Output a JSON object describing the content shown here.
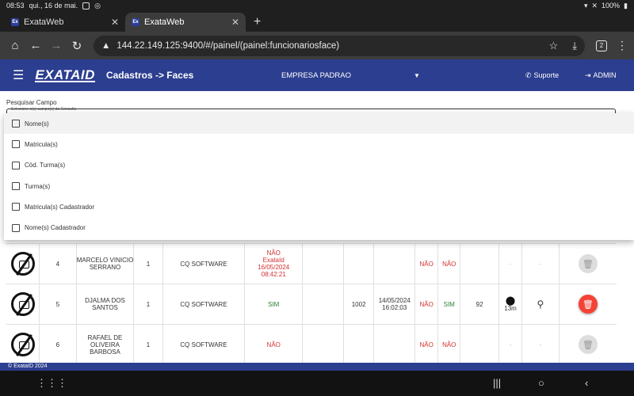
{
  "status": {
    "time": "08:53",
    "date": "qui., 16 de mai.",
    "battery": "100%"
  },
  "tabs": [
    {
      "title": "ExataWeb",
      "favicon": "Ex"
    },
    {
      "title": "ExataWeb",
      "favicon": "Ex"
    }
  ],
  "browser": {
    "url": "144.22.149.125:9400/#/painel/(painel:funcionariosface)",
    "tab_count": "2"
  },
  "app": {
    "logo": "EXATAID",
    "breadcrumb": "Cadastros -> Faces",
    "company": "EMPRESA PADRAO",
    "support": "Suporte",
    "admin": "ADMIN"
  },
  "search": {
    "label": "Pesquisar Campo",
    "field_label": "Selecione o(s) campo(s) da Consulta"
  },
  "dropdown": {
    "options": [
      "Nome(s)",
      "Matricula(s)",
      "Cód. Turma(s)",
      "Turma(s)",
      "Matricula(s) Cadastrador",
      "Nome(s) Cadastrador"
    ]
  },
  "rows": [
    {
      "index": "4",
      "name": "MARCELO VINICIO SERRANO",
      "qty": "1",
      "software": "CQ SOFTWARE",
      "status": "NÃO",
      "status_by": "ExataId",
      "status_date": "16/05/2024",
      "status_time": "08:42:21",
      "matricula": "",
      "date": "",
      "time": "",
      "flag1": "NÃO",
      "flag2": "NÃO",
      "num": "",
      "distance": "",
      "pin": "-",
      "mag": "-"
    },
    {
      "index": "5",
      "name": "DJALMA DOS SANTOS",
      "qty": "1",
      "software": "CQ SOFTWARE",
      "status": "SIM",
      "status_by": "",
      "status_date": "",
      "status_time": "",
      "matricula": "1002",
      "date": "14/05/2024",
      "time": "16:02:03",
      "flag1": "NÃO",
      "flag2": "SIM",
      "num": "92",
      "distance": "13m",
      "pin": "",
      "mag": ""
    },
    {
      "index": "6",
      "name": "RAFAEL DE OLIVEIRA BARBOSA",
      "qty": "1",
      "software": "CQ SOFTWARE",
      "status": "NÃO",
      "status_by": "",
      "status_date": "",
      "status_time": "",
      "matricula": "",
      "date": "",
      "time": "",
      "flag1": "NÃO",
      "flag2": "NÃO",
      "num": "",
      "distance": "",
      "pin": "-",
      "mag": "-"
    }
  ],
  "footer": "© ExataID 2024",
  "colors": {
    "primary": "#2c3e8f",
    "danger": "#f44336",
    "success": "#2e7d32",
    "error_text": "#d32f2f"
  }
}
